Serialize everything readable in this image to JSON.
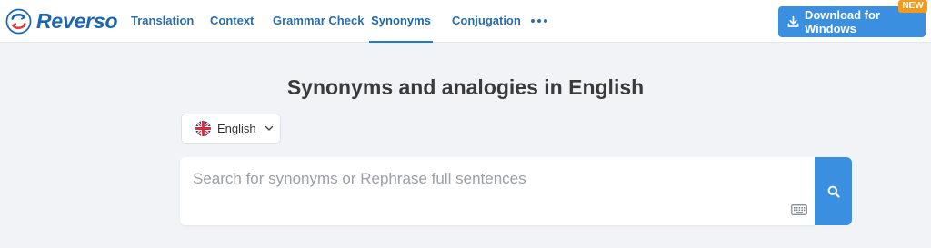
{
  "brand": {
    "name": "Reverso"
  },
  "nav": {
    "items": [
      {
        "label": "Translation"
      },
      {
        "label": "Context"
      },
      {
        "label": "Grammar Check"
      },
      {
        "label": "Synonyms"
      },
      {
        "label": "Conjugation"
      }
    ],
    "active": "Synonyms",
    "more_icon": "more-horizontal-icon"
  },
  "download": {
    "label": "Download for Windows",
    "badge": "NEW",
    "icon": "download-icon"
  },
  "page": {
    "heading": "Synonyms and analogies in English"
  },
  "language": {
    "selected": "English",
    "flag_icon": "uk-flag-icon"
  },
  "search": {
    "placeholder": "Search for synonyms or Rephrase full sentences",
    "value": "",
    "keyboard_icon": "keyboard-icon",
    "button_icon": "search-icon"
  },
  "colors": {
    "accent": "#3b8fe0",
    "brand": "#1a67b0",
    "badge": "#f39a1d",
    "background": "#f1f3f6"
  }
}
